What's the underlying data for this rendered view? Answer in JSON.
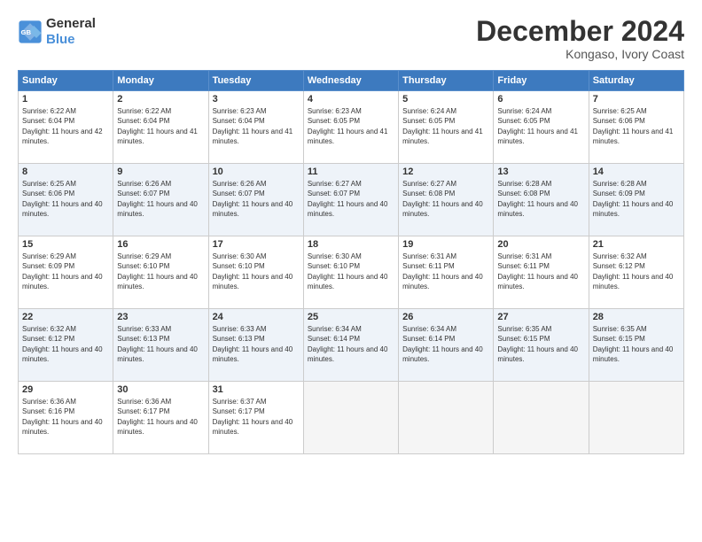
{
  "logo": {
    "line1": "General",
    "line2": "Blue"
  },
  "title": "December 2024",
  "subtitle": "Kongaso, Ivory Coast",
  "days_of_week": [
    "Sunday",
    "Monday",
    "Tuesday",
    "Wednesday",
    "Thursday",
    "Friday",
    "Saturday"
  ],
  "weeks": [
    [
      {
        "day": "1",
        "sunrise": "6:22 AM",
        "sunset": "6:04 PM",
        "daylight": "11 hours and 42 minutes."
      },
      {
        "day": "2",
        "sunrise": "6:22 AM",
        "sunset": "6:04 PM",
        "daylight": "11 hours and 41 minutes."
      },
      {
        "day": "3",
        "sunrise": "6:23 AM",
        "sunset": "6:04 PM",
        "daylight": "11 hours and 41 minutes."
      },
      {
        "day": "4",
        "sunrise": "6:23 AM",
        "sunset": "6:05 PM",
        "daylight": "11 hours and 41 minutes."
      },
      {
        "day": "5",
        "sunrise": "6:24 AM",
        "sunset": "6:05 PM",
        "daylight": "11 hours and 41 minutes."
      },
      {
        "day": "6",
        "sunrise": "6:24 AM",
        "sunset": "6:05 PM",
        "daylight": "11 hours and 41 minutes."
      },
      {
        "day": "7",
        "sunrise": "6:25 AM",
        "sunset": "6:06 PM",
        "daylight": "11 hours and 41 minutes."
      }
    ],
    [
      {
        "day": "8",
        "sunrise": "6:25 AM",
        "sunset": "6:06 PM",
        "daylight": "11 hours and 40 minutes."
      },
      {
        "day": "9",
        "sunrise": "6:26 AM",
        "sunset": "6:07 PM",
        "daylight": "11 hours and 40 minutes."
      },
      {
        "day": "10",
        "sunrise": "6:26 AM",
        "sunset": "6:07 PM",
        "daylight": "11 hours and 40 minutes."
      },
      {
        "day": "11",
        "sunrise": "6:27 AM",
        "sunset": "6:07 PM",
        "daylight": "11 hours and 40 minutes."
      },
      {
        "day": "12",
        "sunrise": "6:27 AM",
        "sunset": "6:08 PM",
        "daylight": "11 hours and 40 minutes."
      },
      {
        "day": "13",
        "sunrise": "6:28 AM",
        "sunset": "6:08 PM",
        "daylight": "11 hours and 40 minutes."
      },
      {
        "day": "14",
        "sunrise": "6:28 AM",
        "sunset": "6:09 PM",
        "daylight": "11 hours and 40 minutes."
      }
    ],
    [
      {
        "day": "15",
        "sunrise": "6:29 AM",
        "sunset": "6:09 PM",
        "daylight": "11 hours and 40 minutes."
      },
      {
        "day": "16",
        "sunrise": "6:29 AM",
        "sunset": "6:10 PM",
        "daylight": "11 hours and 40 minutes."
      },
      {
        "day": "17",
        "sunrise": "6:30 AM",
        "sunset": "6:10 PM",
        "daylight": "11 hours and 40 minutes."
      },
      {
        "day": "18",
        "sunrise": "6:30 AM",
        "sunset": "6:10 PM",
        "daylight": "11 hours and 40 minutes."
      },
      {
        "day": "19",
        "sunrise": "6:31 AM",
        "sunset": "6:11 PM",
        "daylight": "11 hours and 40 minutes."
      },
      {
        "day": "20",
        "sunrise": "6:31 AM",
        "sunset": "6:11 PM",
        "daylight": "11 hours and 40 minutes."
      },
      {
        "day": "21",
        "sunrise": "6:32 AM",
        "sunset": "6:12 PM",
        "daylight": "11 hours and 40 minutes."
      }
    ],
    [
      {
        "day": "22",
        "sunrise": "6:32 AM",
        "sunset": "6:12 PM",
        "daylight": "11 hours and 40 minutes."
      },
      {
        "day": "23",
        "sunrise": "6:33 AM",
        "sunset": "6:13 PM",
        "daylight": "11 hours and 40 minutes."
      },
      {
        "day": "24",
        "sunrise": "6:33 AM",
        "sunset": "6:13 PM",
        "daylight": "11 hours and 40 minutes."
      },
      {
        "day": "25",
        "sunrise": "6:34 AM",
        "sunset": "6:14 PM",
        "daylight": "11 hours and 40 minutes."
      },
      {
        "day": "26",
        "sunrise": "6:34 AM",
        "sunset": "6:14 PM",
        "daylight": "11 hours and 40 minutes."
      },
      {
        "day": "27",
        "sunrise": "6:35 AM",
        "sunset": "6:15 PM",
        "daylight": "11 hours and 40 minutes."
      },
      {
        "day": "28",
        "sunrise": "6:35 AM",
        "sunset": "6:15 PM",
        "daylight": "11 hours and 40 minutes."
      }
    ],
    [
      {
        "day": "29",
        "sunrise": "6:36 AM",
        "sunset": "6:16 PM",
        "daylight": "11 hours and 40 minutes."
      },
      {
        "day": "30",
        "sunrise": "6:36 AM",
        "sunset": "6:17 PM",
        "daylight": "11 hours and 40 minutes."
      },
      {
        "day": "31",
        "sunrise": "6:37 AM",
        "sunset": "6:17 PM",
        "daylight": "11 hours and 40 minutes."
      },
      null,
      null,
      null,
      null
    ]
  ]
}
